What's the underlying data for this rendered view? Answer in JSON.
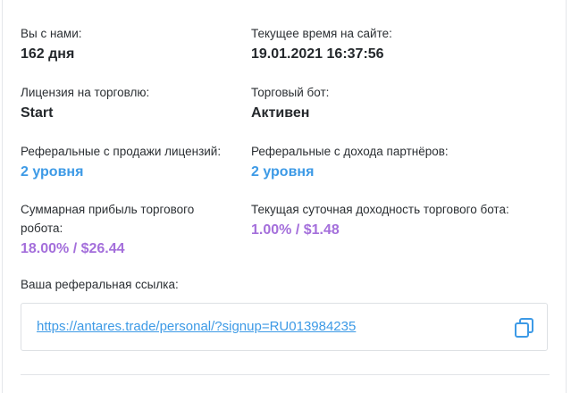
{
  "stats": {
    "with_us": {
      "label": "Вы с нами:",
      "value": "162 дня"
    },
    "site_time": {
      "label": "Текущее время на сайте:",
      "value": "19.01.2021 16:37:56"
    },
    "license": {
      "label": "Лицензия на торговлю:",
      "value": "Start"
    },
    "bot": {
      "label": "Торговый бот:",
      "value": "Активен"
    },
    "ref_license": {
      "label": "Реферальные с продажи лицензий:",
      "value": "2 уровня"
    },
    "ref_partners": {
      "label": "Реферальные с дохода партнёров:",
      "value": "2 уровня"
    },
    "total_profit": {
      "label": "Суммарная прибыль торгового робота:",
      "value": "18.00% / $26.44"
    },
    "daily_yield": {
      "label": "Текущая суточная доходность торгового бота:",
      "value": "1.00% / $1.48"
    }
  },
  "referral": {
    "label": "Ваша реферальная ссылка:",
    "url": "https://antares.trade/personal/?signup=RU013984235"
  },
  "colors": {
    "accent_blue": "#3d9ae6",
    "accent_purple": "#a46fdb",
    "text_dark": "#24282c"
  },
  "icons": {
    "copy": "copy-icon"
  }
}
